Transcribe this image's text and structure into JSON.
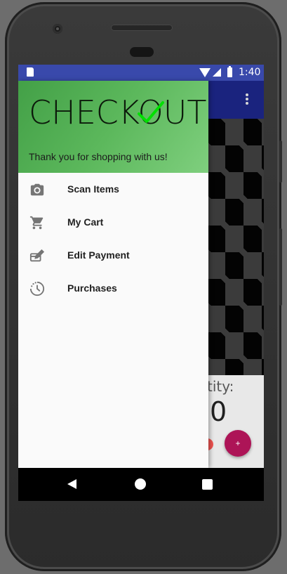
{
  "status_bar": {
    "time": "1:40"
  },
  "drawer": {
    "header": {
      "title": "CHECKOUT",
      "subtitle": "Thank you for shopping with us!"
    },
    "items": [
      {
        "label": "Scan Items",
        "icon": "camera-icon"
      },
      {
        "label": "My Cart",
        "icon": "cart-icon"
      },
      {
        "label": "Edit Payment",
        "icon": "payment-icon"
      },
      {
        "label": "Purchases",
        "icon": "history-icon"
      }
    ]
  },
  "background": {
    "quantity_label_visible": "tity:",
    "quantity_value": "0",
    "fab_label": "+"
  },
  "colors": {
    "status_bar": "#3949ab",
    "app_bar": "#1a237e",
    "header_green": "#4caf50",
    "checkmark": "#00e000",
    "fab": "#ad1457"
  }
}
